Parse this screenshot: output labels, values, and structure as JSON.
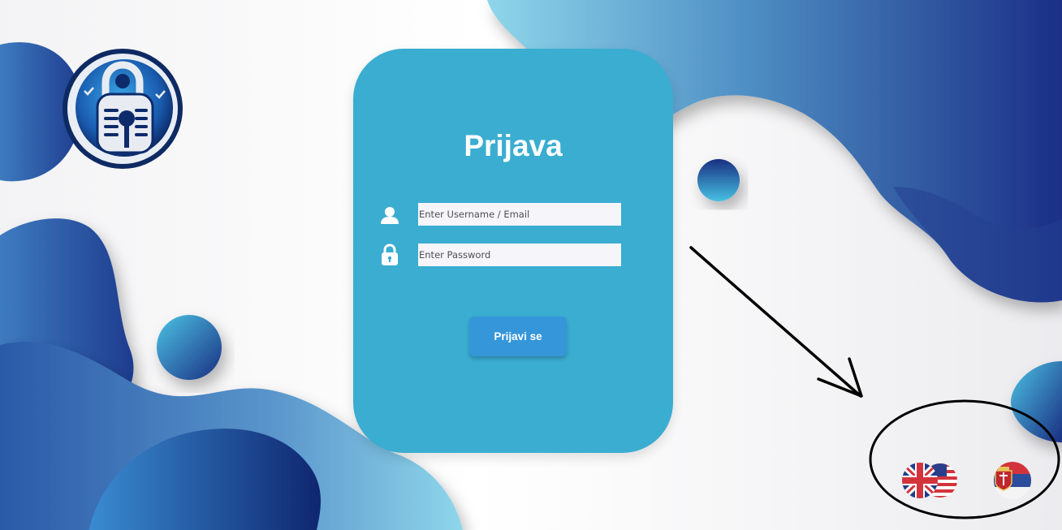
{
  "login": {
    "title": "Prijava",
    "username_placeholder": "Enter Username / Email",
    "username_value": "",
    "password_placeholder": "Enter Password",
    "password_value": "",
    "submit_label": "Prijavi se"
  },
  "languages": [
    {
      "code": "en",
      "icon": "uk-us-flag-icon"
    },
    {
      "code": "sr",
      "icon": "serbia-flag-icon"
    }
  ],
  "icons": {
    "user": "user-icon",
    "lock": "lock-icon",
    "logo": "padlock-logo-icon"
  },
  "colors": {
    "card": "#3aadd1",
    "button": "#3596d9",
    "wave_dark": "#1f3d8f",
    "wave_light": "#8fd6ea",
    "input_bg": "#f5f5fa"
  }
}
